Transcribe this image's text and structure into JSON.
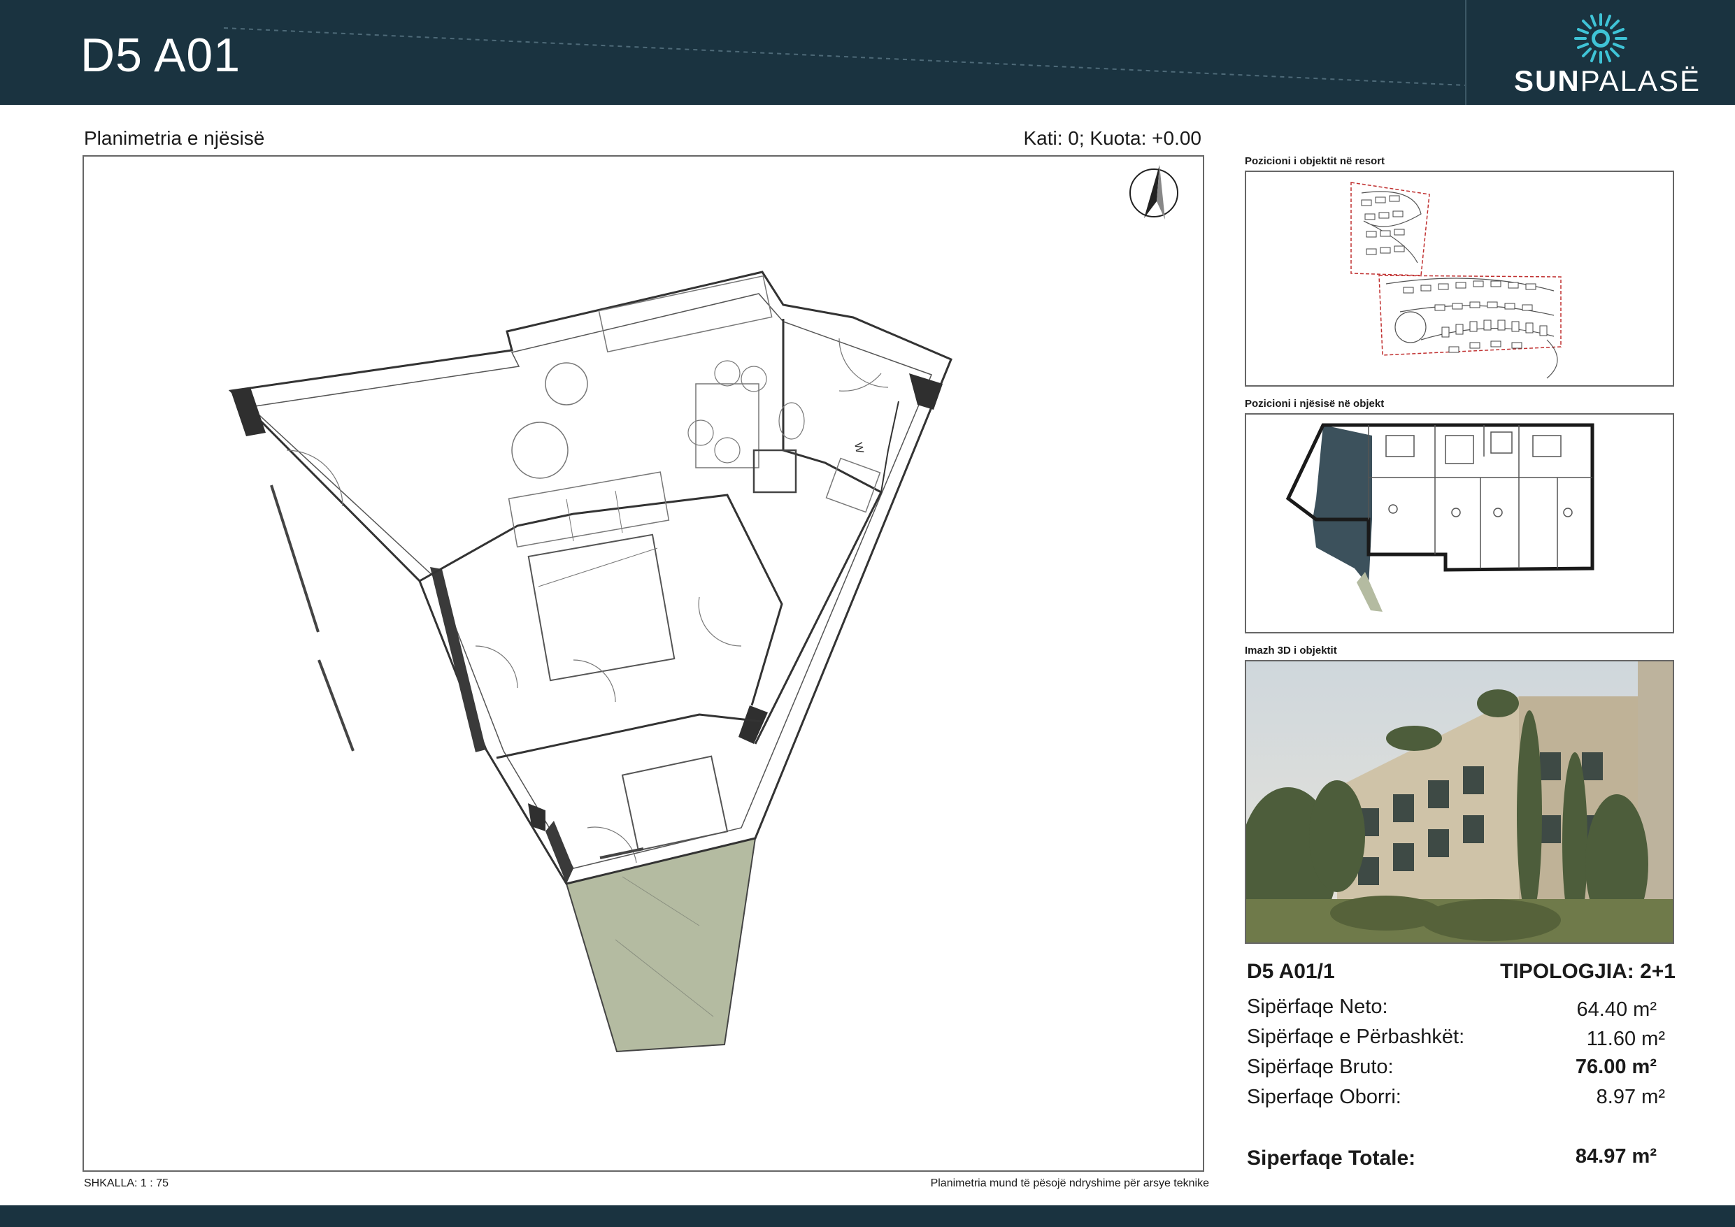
{
  "header": {
    "title": "D5 A01",
    "logo_bold": "SUN",
    "logo_rest": "PALASË"
  },
  "colors": {
    "header_bg": "#1a3340",
    "garden": "#b4bba1",
    "wall": "#2f2f2f"
  },
  "plan": {
    "title": "Planimetria e njësisë",
    "floor_info": "Kati: 0; Kuota: +0.00",
    "scale": "SHKALLA: 1 : 75",
    "disclaimer": "Planimetria mund të pësojë ndryshime për arsye teknike",
    "room_mark": "W"
  },
  "sidebar": {
    "resort_label": "Pozicioni i objektit në resort",
    "building_label": "Pozicioni i njësisë në objekt",
    "render_label": "Imazh 3D i objektit"
  },
  "unit": {
    "code": "D5 A01/1",
    "typology": "TIPOLOGJIA: 2+1",
    "areas": [
      {
        "label": "Sipërfaqe Neto:",
        "value": "64.40 m²"
      },
      {
        "label": "Sipërfaqe e Përbashkët:",
        "value": "11.60 m²"
      },
      {
        "label": "Sipërfaqe Bruto:",
        "value": "76.00 m²"
      },
      {
        "label": "Siperfaqe Oborri:",
        "value": "8.97 m²"
      }
    ],
    "total_label": "Siperfaqe Totale:",
    "total_value": "84.97 m²"
  }
}
